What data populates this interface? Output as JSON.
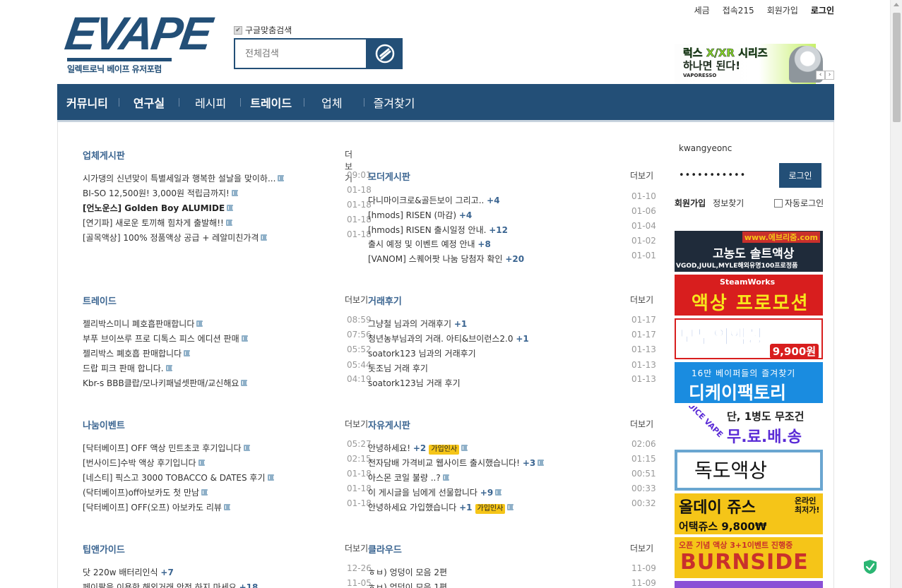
{
  "header": {
    "logo_text": "EVAPE",
    "logo_tagline": "일렉트로닉 베이프 유저포럼",
    "google_search_label": "구글맞춤검색",
    "search_placeholder": "전체검색",
    "top_links": {
      "tax": "세금",
      "visitors": "접속215",
      "signup": "회원가입",
      "login": "로그인"
    }
  },
  "top_banner": {
    "line1": "럭스 X/XR 시리즈",
    "line2": "하나면 된다!",
    "brand": "VAPORESSO"
  },
  "nav": [
    "커뮤니티",
    "연구실",
    "레시피",
    "트레이드",
    "업체",
    "즐겨찾기"
  ],
  "boards": {
    "vendor": {
      "title": "업체게시판",
      "more": "더보기",
      "posts": [
        {
          "text": "시가댕의 신년맞이 특별세일과 행복한 설날을 맞이하...",
          "date": "09:01"
        },
        {
          "text": "BI-SO 12,500원! 3,000원 적립금까지!",
          "date": "01-18"
        },
        {
          "text": "[언노운스] Golden Boy ALUMIDE",
          "date": "01-18"
        },
        {
          "text": "[연기파] 새로운 토끼해 힘차게 출발해!!",
          "date": "01-18"
        },
        {
          "text": "[골목액상] 100% 정품액상 공급 + 레알미친가격",
          "date": "01-18"
        }
      ]
    },
    "moderator": {
      "title": "모더게시판",
      "more": "더보기",
      "posts": [
        {
          "text": "다니마이크로&골든보이 그리고..",
          "count": "+4",
          "date": "01-10"
        },
        {
          "text": "[hmods] RISEN (마감)",
          "count": "+4",
          "date": "01-06"
        },
        {
          "text": "[hmods] RISEN 출시일정 안내.",
          "count": "+12",
          "date": "01-04"
        },
        {
          "text": "출시 예정 및 이벤트 예정 안내",
          "count": "+8",
          "date": "01-02"
        },
        {
          "text": "[VANOM] 스퀘어팟 나눔 당첨자 확인",
          "count": "+20",
          "date": "01-01"
        }
      ]
    },
    "trade": {
      "title": "트레이드",
      "more": "더보기",
      "posts": [
        {
          "text": "젤리박스미니 폐호흡판매합니다",
          "date": "08:59"
        },
        {
          "text": "부푸 브이쓰루 프로 디톡스 피스 에디션 판매",
          "date": "07:56"
        },
        {
          "text": "젤리박스 폐호흡 판매합니다",
          "date": "05:52"
        },
        {
          "text": "드랍 피크 판매 합니다.",
          "date": "05:44"
        },
        {
          "text": "Kbr-s BBB클랍/모나키패널셋판매/교신해요",
          "date": "04:19"
        }
      ]
    },
    "trade_review": {
      "title": "거래후기",
      "more": "더보기",
      "posts": [
        {
          "text": "그냥철 님과의 거래후기",
          "count": "+1",
          "date": "01-17"
        },
        {
          "text": "청년농부님과의 거래. 아티&브이런스2.0",
          "count": "+1",
          "date": "01-17"
        },
        {
          "text": "soatork123 님과의 거래후기",
          "count": "",
          "date": "01-13"
        },
        {
          "text": "돗조님 거래 후기",
          "count": "",
          "date": "01-13"
        },
        {
          "text": "soatork123님 거래 후기",
          "count": "",
          "date": "01-13"
        }
      ]
    },
    "giveaway": {
      "title": "나눔이벤트",
      "more": "더보기",
      "posts": [
        {
          "text": "[닥터베이프] OFF 액상 민트초코 후기입니다",
          "date": "05:27"
        },
        {
          "text": "[번사이드]수박 액상 후기입니다",
          "date": "02:15"
        },
        {
          "text": "[네스티] 픽스고 3000 TOBACCO & DATES 후기",
          "date": "01-18"
        },
        {
          "text": "(닥터베이프)off아보카도 첫 만남",
          "date": "01-18"
        },
        {
          "text": "[닥터베이프] OFF(오프) 아보카도 리뷰",
          "date": "01-18"
        }
      ]
    },
    "free": {
      "title": "자유게시판",
      "more": "더보기",
      "posts": [
        {
          "text": "안녕하세요!",
          "count": "+2",
          "tag": "가입인사",
          "date": "02:06"
        },
        {
          "text": "전자담배 가격비교 웹사이트 출시했습니다!",
          "count": "+3",
          "tag": "",
          "date": "01:15"
        },
        {
          "text": "아스몬 코일 불량 ..?",
          "count": "",
          "tag": "",
          "date": "00:51"
        },
        {
          "text": "이 게시글을 님에게 선물합니다",
          "count": "+9",
          "tag": "",
          "date": "00:33"
        },
        {
          "text": "안녕하세요 가입했습니다",
          "count": "+1",
          "tag": "가입인사",
          "date": "00:32"
        }
      ]
    },
    "tips": {
      "title": "팁앤가이드",
      "more": "더보기",
      "posts": [
        {
          "text": "닷 220w 배터리인식",
          "count": "+7",
          "date": "12-26"
        },
        {
          "text": "페이팔을 이용한 해외거래 안전 하지 마세요",
          "count": "+18",
          "date": "11-05"
        }
      ]
    },
    "cloud": {
      "title": "클라우드",
      "more": "더보기",
      "posts": [
        {
          "text": "ㅎㅂ) 엉덩이 모음 2편",
          "date": "11-09"
        },
        {
          "text": "ㅎㅂ) 엉덩이 모음 1편",
          "date": "11-09"
        }
      ]
    }
  },
  "login": {
    "username": "kwangyeonc",
    "password_mask": "•••••••••••",
    "button": "로그인",
    "signup": "회원가입",
    "find": "정보찾기",
    "auto_login": "자동로그인"
  },
  "ads": [
    {
      "line1": "www.에브리줌.com",
      "line2": "고농도 솔트액상",
      "line3": "VGOD,JUUL,MYLE해외유명100프로정품"
    },
    {
      "line1": "SteamWorks",
      "line2": "액상 프로모션"
    },
    {
      "line1": "모두의액상",
      "line2": "9,900원"
    },
    {
      "line1": "16만 베이퍼들의 즐겨찾기",
      "line2": "디케이팩토리"
    },
    {
      "line1": "JUICE VAPE",
      "line2": "단, 1병도 무조건",
      "line3": "무.료.배.송"
    },
    {
      "line1": "독도액상"
    },
    {
      "line1": "올데이 쥬스",
      "line2": "온라인 최저가!",
      "line3": "어택쥬스 9,800₩"
    },
    {
      "line1": "오픈 기념 액상 3+1이벤트 진행중",
      "line2": "BURNSIDE"
    }
  ]
}
